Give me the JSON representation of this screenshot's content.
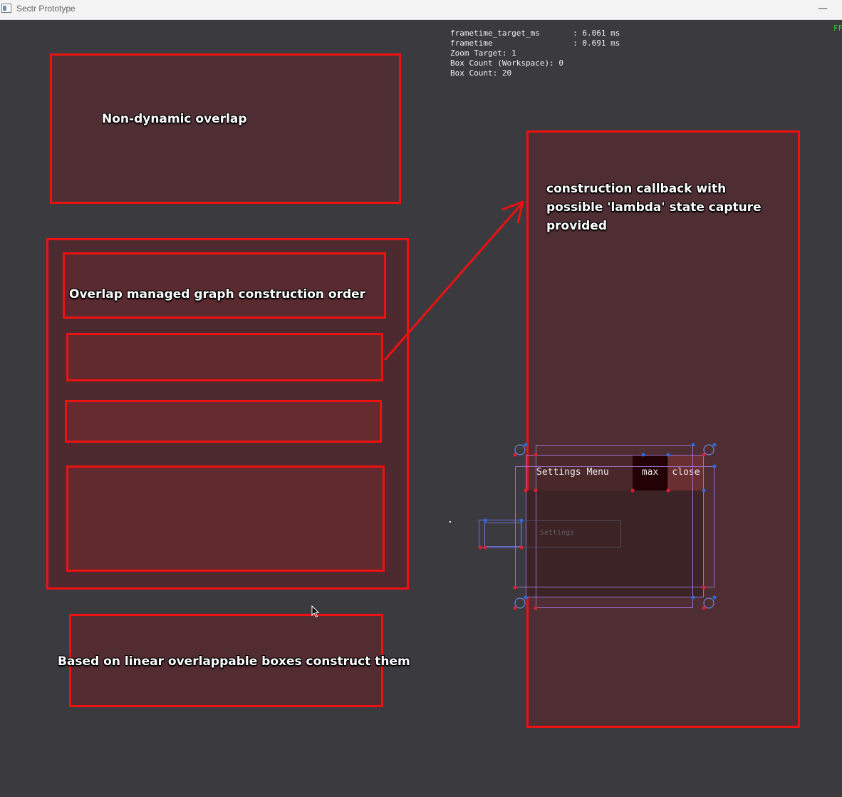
{
  "window": {
    "title": "Sectr Prototype",
    "minimize": "—"
  },
  "debug": {
    "lines": [
      "frametime_target_ms       : 6.061 ms",
      "frametime                 : 0.691 ms",
      "Zoom Target: 1",
      "Box Count (Workspace): 0",
      "Box Count: 20"
    ],
    "fps_fragment": "FF"
  },
  "annotations": {
    "non_dynamic": "Non-dynamic overlap",
    "overlap_managed": "Overlap managed graph construction order",
    "linear": "Based on linear overlappable boxes construct them",
    "callback_line1": "construction callback with",
    "callback_line2": "possible 'lambda' state capture",
    "callback_line3": "provided"
  },
  "settings_menu": {
    "title": "Settings Menu",
    "max": "max",
    "close": "close",
    "mini_label": "Settings"
  },
  "colors": {
    "annotation_border": "#ee1111",
    "background": "#3a3a3f",
    "outline": "#9b6fcf",
    "fps": "#28d028"
  }
}
